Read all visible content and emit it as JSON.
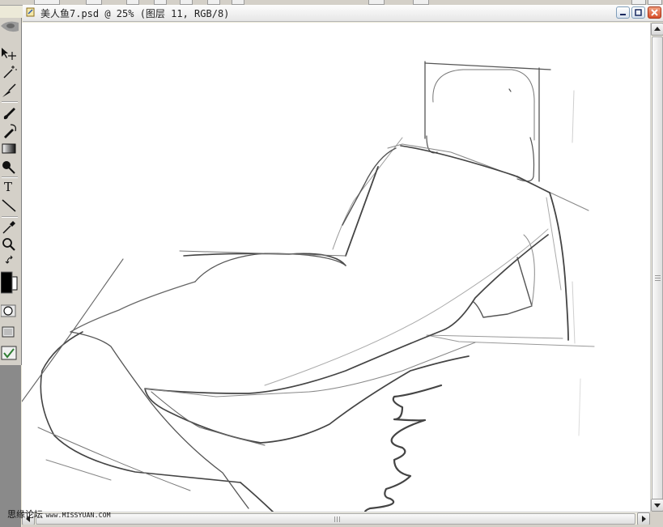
{
  "document": {
    "title": "美人鱼7.psd @ 25% (图层 11, RGB/8)"
  },
  "window_controls": {
    "minimize_icon": "minimize-icon",
    "maximize_icon": "maximize-icon",
    "close_icon": "close-icon"
  },
  "toolbox": {
    "type_tool_letter": "T",
    "foreground_color": "#000000",
    "background_color": "#ffffff"
  },
  "watermark": {
    "site_name": "思缘论坛",
    "site_url": "www.MISSYUAN.COM"
  },
  "colors": {
    "sketch_stroke": "#3a3a3a",
    "canvas_background": "#ffffff",
    "close_button": "#d8502c"
  }
}
